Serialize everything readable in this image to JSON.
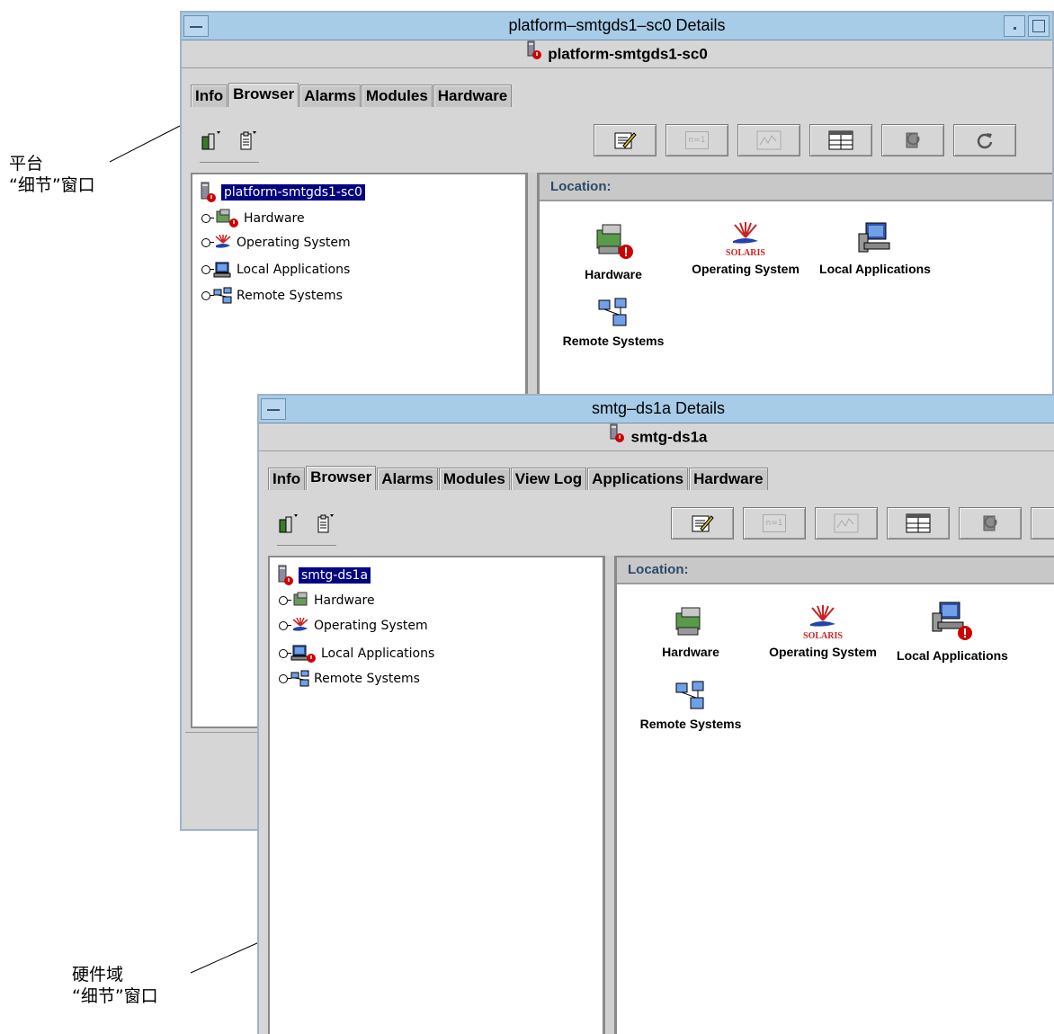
{
  "annotations": {
    "platform": {
      "line1": "平台",
      "line2": "“细节”窗口"
    },
    "domain": {
      "line1": "硬件域",
      "line2": "“细节”窗口"
    }
  },
  "platform_window": {
    "title": "platform–smtgds1–sc0 Details",
    "object_name": "platform-smtgds1-sc0",
    "tabs": [
      "Info",
      "Browser",
      "Alarms",
      "Modules",
      "Hardware"
    ],
    "active_tab": "Browser",
    "tree": {
      "root": "platform-smtgds1-sc0",
      "children": [
        "Hardware",
        "Operating System",
        "Local Applications",
        "Remote Systems"
      ]
    },
    "location_label": "Location:",
    "details": [
      "Hardware",
      "Operating System",
      "Local Applications",
      "Remote Systems"
    ],
    "toolbar_button_faces": [
      "n=1"
    ]
  },
  "domain_window": {
    "title": "smtg–ds1a Details",
    "object_name": "smtg-ds1a",
    "tabs": [
      "Info",
      "Browser",
      "Alarms",
      "Modules",
      "View Log",
      "Applications",
      "Hardware"
    ],
    "active_tab": "Browser",
    "tree": {
      "root": "smtg-ds1a",
      "children": [
        "Hardware",
        "Operating System",
        "Local Applications",
        "Remote Systems"
      ]
    },
    "location_label": "Location:",
    "details": [
      "Hardware",
      "Operating System",
      "Local Applications",
      "Remote Systems"
    ],
    "toolbar_button_faces": [
      "n=1"
    ]
  },
  "icons": {
    "solaris_logo_text": "SOLARIS"
  },
  "colors": {
    "titlebar": "#a7cce8",
    "selection": "#000080",
    "alarm": "#cc0000"
  }
}
